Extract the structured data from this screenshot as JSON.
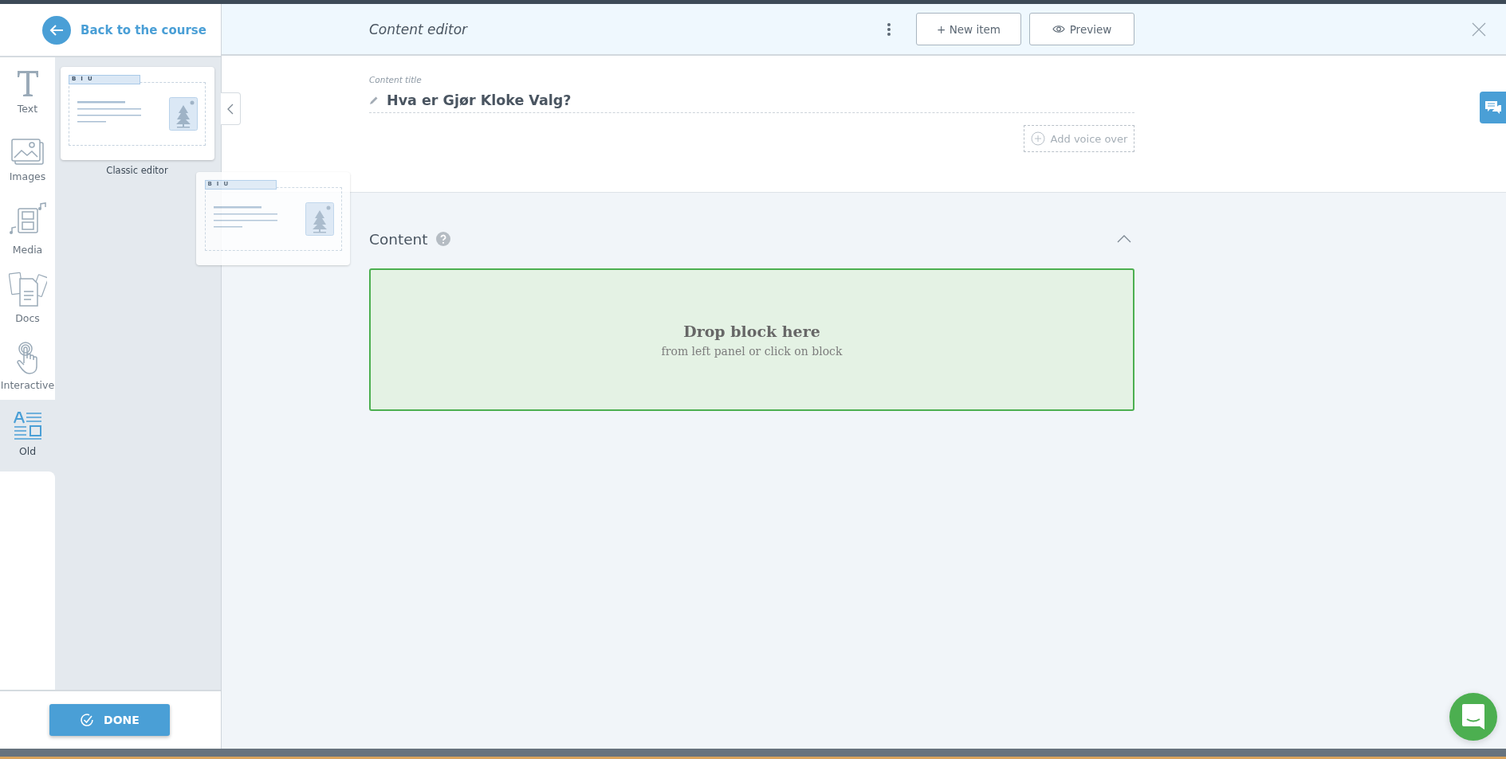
{
  "back_link": {
    "label": "Back to the course"
  },
  "categories": [
    {
      "kind": "text",
      "label": "Text",
      "selected": false
    },
    {
      "kind": "images",
      "label": "Images",
      "selected": false
    },
    {
      "kind": "media",
      "label": "Media",
      "selected": false
    },
    {
      "kind": "docs",
      "label": "Docs",
      "selected": false
    },
    {
      "kind": "interactive",
      "label": "Interactive",
      "selected": false
    },
    {
      "kind": "old",
      "label": "Old",
      "selected": true
    }
  ],
  "blocks": [
    {
      "label": "Classic editor",
      "toolbar": [
        "B",
        "I",
        "U"
      ]
    }
  ],
  "dragged_block": {
    "toolbar": [
      "B",
      "I",
      "U"
    ]
  },
  "done_button": {
    "label": "DONE"
  },
  "editor": {
    "title": "Content editor",
    "buttons": [
      {
        "kind": "new",
        "label": "+ New item"
      },
      {
        "kind": "preview",
        "label": "Preview"
      }
    ]
  },
  "content_title": {
    "label": "Content title",
    "value": "Hva er Gjør Kloke Valg?"
  },
  "voice_over": {
    "label": "Add voice over"
  },
  "content_section": {
    "heading": "Content",
    "expanded": true,
    "drop_zone": {
      "title": "Drop block here",
      "subtitle": "from left panel or click on block"
    }
  }
}
